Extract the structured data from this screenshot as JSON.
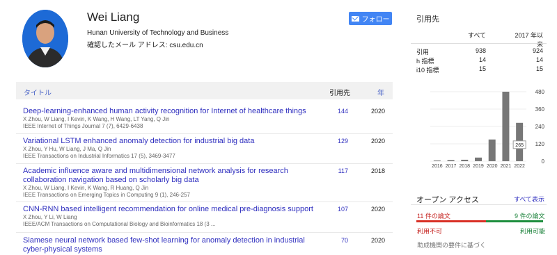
{
  "profile": {
    "name": "Wei Liang",
    "affiliation": "Hunan University of Technology and Business",
    "email_label": "確認したメール アドレス: csu.edu.cn",
    "follow_label": "フォロー"
  },
  "table": {
    "col_title": "タイトル",
    "col_cited": "引用先",
    "col_year": "年",
    "rows": [
      {
        "title": "Deep-learning-enhanced human activity recognition for Internet of healthcare things",
        "authors": "X Zhou, W Liang, I Kevin, K Wang, H Wang, LT Yang, Q Jin",
        "venue": "IEEE Internet of Things Journal 7 (7), 6429-6438",
        "cited": "144",
        "year": "2020"
      },
      {
        "title": "Variational LSTM enhanced anomaly detection for industrial big data",
        "authors": "X Zhou, Y Hu, W Liang, J Ma, Q Jin",
        "venue": "IEEE Transactions on Industrial Informatics 17 (5), 3469-3477",
        "cited": "129",
        "year": "2020"
      },
      {
        "title": "Academic influence aware and multidimensional network analysis for research collaboration navigation based on scholarly big data",
        "authors": "X Zhou, W Liang, I Kevin, K Wang, R Huang, Q Jin",
        "venue": "IEEE Transactions on Emerging Topics in Computing 9 (1), 246-257",
        "cited": "117",
        "year": "2018"
      },
      {
        "title": "CNN-RNN based intelligent recommendation for online medical pre-diagnosis support",
        "authors": "X Zhou, Y Li, W Liang",
        "venue": "IEEE/ACM Transactions on Computational Biology and Bioinformatics 18 (3 ...",
        "cited": "107",
        "year": "2020"
      },
      {
        "title": "Siamese neural network based few-shot learning for anomaly detection in industrial cyber-physical systems",
        "authors": "",
        "venue": "",
        "cited": "70",
        "year": "2020"
      }
    ]
  },
  "citations": {
    "title": "引用先",
    "col_all": "すべて",
    "col_since": "2017 年以来",
    "rows": [
      {
        "label": "引用",
        "all": "938",
        "since": "924"
      },
      {
        "label": "h 指標",
        "all": "14",
        "since": "14"
      },
      {
        "label": "i10 指標",
        "all": "15",
        "since": "15"
      }
    ]
  },
  "chart_data": {
    "type": "bar",
    "categories": [
      "2016",
      "2017",
      "2018",
      "2019",
      "2020",
      "2021",
      "2022"
    ],
    "values": [
      5,
      8,
      10,
      25,
      150,
      480,
      265
    ],
    "ylim": [
      0,
      480
    ],
    "yticks": [
      "480",
      "360",
      "240",
      "120",
      "0"
    ],
    "annotation": "265",
    "bar_color": "#777777"
  },
  "open_access": {
    "title": "オープン アクセス",
    "view_all": "すべて表示",
    "not_available_count": "11 件の論文",
    "available_count": "9 件の論文",
    "not_available_label": "利用不可",
    "available_label": "利用可能",
    "mandate": "助成機関の要件に基づく"
  }
}
